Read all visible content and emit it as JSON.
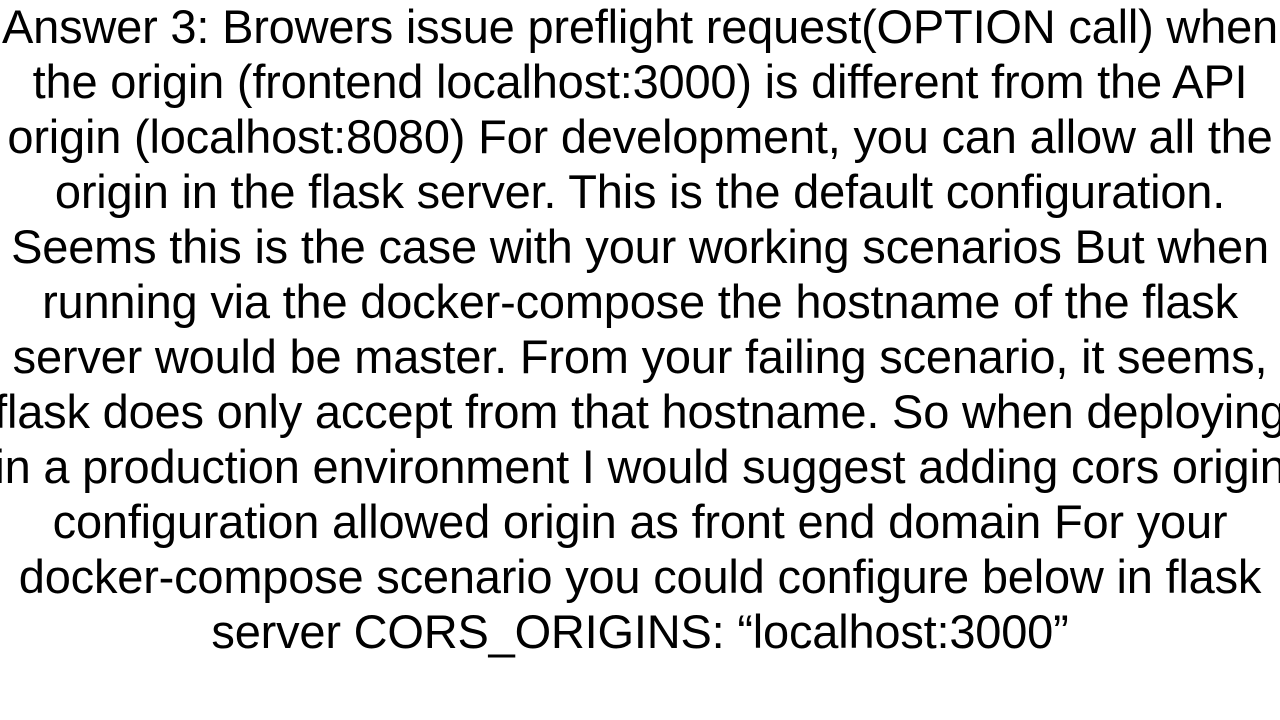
{
  "answer": {
    "label": "Answer 3:",
    "body": "Browers issue preflight request(OPTION call) when the origin (frontend localhost:3000) is different from the API origin (localhost:8080) For development, you can allow all the origin in the flask server. This is the default configuration. Seems this is the case with your working scenarios But when running via the docker-compose the hostname of the flask server would be master. From your failing scenario, it seems, flask does only accept from that hostname. So when deploying in a production environment I would suggest adding cors origin configuration allowed origin as front end domain For your docker-compose scenario you could configure below in flask server CORS_ORIGINS: “localhost:3000”"
  }
}
